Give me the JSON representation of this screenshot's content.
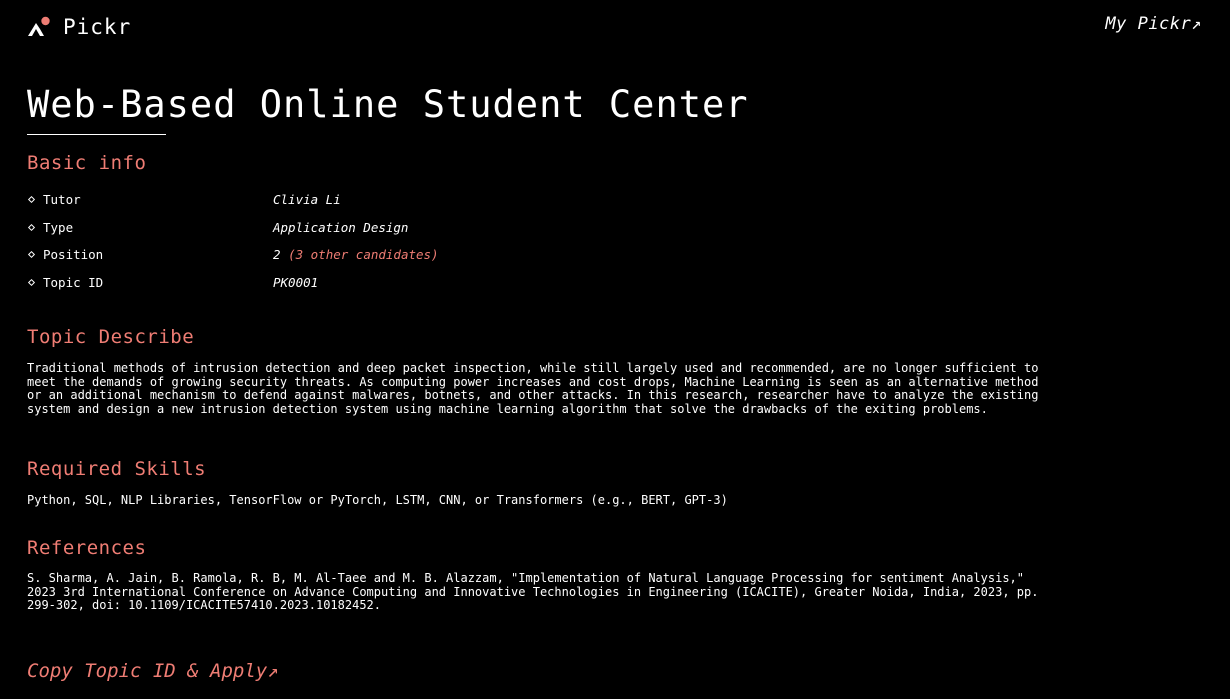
{
  "header": {
    "brand": "Pickr",
    "my_link": "My Pickr↗"
  },
  "title": "Web-Based Online Student Center",
  "basic_info": {
    "heading": "Basic info",
    "rows": [
      {
        "key": "Tutor",
        "value": "Clivia Li",
        "note": ""
      },
      {
        "key": "Type",
        "value": "Application Design",
        "note": ""
      },
      {
        "key": "Position",
        "value": "2",
        "note": "(3 other candidates)"
      },
      {
        "key": "Topic ID",
        "value": "PK0001",
        "note": ""
      }
    ]
  },
  "describe": {
    "heading": "Topic Describe",
    "text": "Traditional methods of intrusion detection and deep packet inspection, while still largely used and recommended, are no longer sufficient to meet the demands of growing security threats. As computing power increases and cost drops, Machine Learning is seen as an alternative method or an additional mechanism to defend against malwares, botnets, and other attacks. In this research, researcher have to analyze the existing system and design a new intrusion detection system using machine learning algorithm that solve the drawbacks of the exiting problems."
  },
  "skills": {
    "heading": "Required Skills",
    "text": "Python, SQL, NLP Libraries, TensorFlow or PyTorch, LSTM, CNN, or Transformers (e.g., BERT, GPT-3)"
  },
  "references": {
    "heading": "References",
    "text": "S. Sharma, A. Jain, B. Ramola, R. B, M. Al-Taee and M. B. Alazzam, \"Implementation of Natural Language Processing for sentiment Analysis,\" 2023 3rd International Conference on Advance Computing and Innovative Technologies in Engineering (ICACITE), Greater Noida, India, 2023, pp. 299-302, doi: 10.1109/ICACITE57410.2023.10182452."
  },
  "apply_link": "Copy Topic ID & Apply↗",
  "colors": {
    "background": "#000000",
    "text": "#ffffff",
    "accent": "#ef7d74"
  },
  "icons": {
    "logo": "pickr-logo-icon",
    "bullet": "diamond-bullet-icon"
  }
}
